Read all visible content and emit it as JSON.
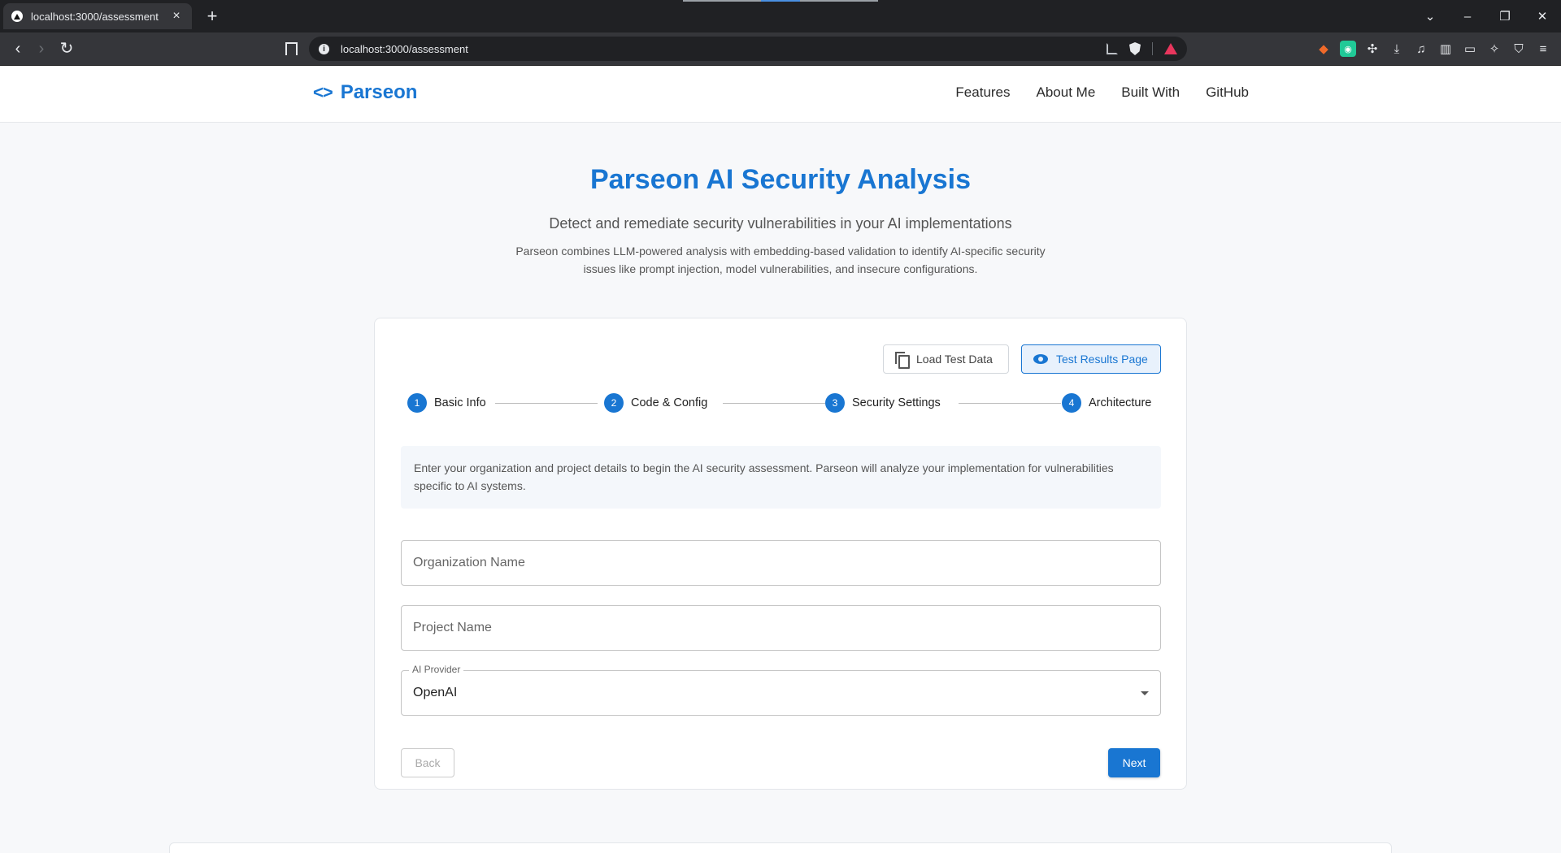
{
  "browser": {
    "tab_title": "localhost:3000/assessment",
    "new_tab": "+",
    "url": "localhost:3000/assessment",
    "window_controls": [
      "⌄",
      "–",
      "❐",
      "✕"
    ]
  },
  "site": {
    "logo_icon": "<>",
    "logo_text": "Parseon",
    "nav": [
      "Features",
      "About Me",
      "Built With",
      "GitHub"
    ]
  },
  "hero": {
    "title": "Parseon AI Security Analysis",
    "subtitle": "Detect and remediate security vulnerabilities in your AI implementations",
    "description": "Parseon combines LLM-powered analysis with embedding-based validation to identify AI-specific security issues like prompt injection, model vulnerabilities, and insecure configurations."
  },
  "card": {
    "load_test_data": "Load Test Data",
    "test_results_page": "Test Results Page",
    "steps": [
      {
        "num": "1",
        "label": "Basic Info"
      },
      {
        "num": "2",
        "label": "Code & Config"
      },
      {
        "num": "3",
        "label": "Security Settings"
      },
      {
        "num": "4",
        "label": "Architecture"
      }
    ],
    "info": "Enter your organization and project details to begin the AI security assessment. Parseon will analyze your implementation for vulnerabilities specific to AI systems.",
    "org_placeholder": "Organization Name",
    "project_placeholder": "Project Name",
    "provider_label": "AI Provider",
    "provider_value": "OpenAI",
    "back": "Back",
    "next": "Next"
  },
  "colors": {
    "accent": "#1976d2"
  }
}
